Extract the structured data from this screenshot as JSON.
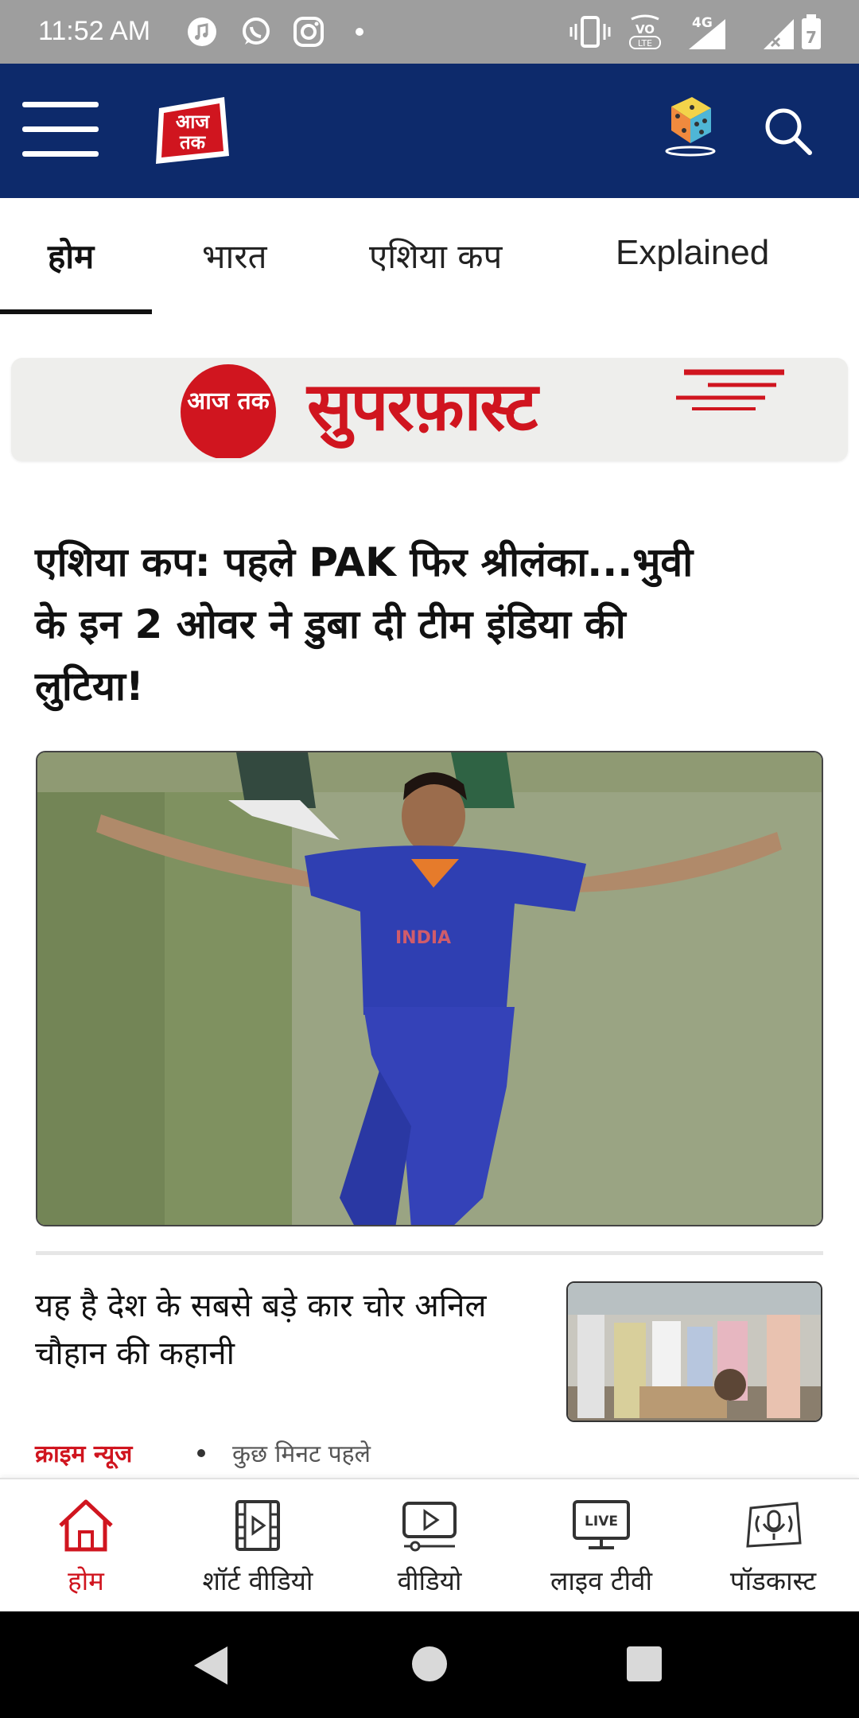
{
  "status_bar": {
    "time": "11:52 AM",
    "network": "4G"
  },
  "header": {
    "logo_text": "आज तक",
    "menu_icon": "hamburger-menu-icon",
    "game_icon": "dice-icon",
    "search_icon": "search-icon",
    "background": "#0d2a6b"
  },
  "tabs": [
    {
      "label": "होम",
      "active": true
    },
    {
      "label": "भारत"
    },
    {
      "label": "एशिया कप"
    },
    {
      "label": "Explained"
    }
  ],
  "banner": {
    "logo_text": "आज तक",
    "title": "सुपरफ़ास्ट"
  },
  "lead_story": {
    "headline": "एशिया कप: पहले PAK फिर श्रीलंका...भुवी के इन 2 ओवर ने डुबा दी टीम इंडिया की लुटिया!"
  },
  "story": {
    "title": "यह है देश के सबसे बड़े कार चोर अनिल चौहान की कहानी",
    "category": "क्राइम न्यूज",
    "time": "कुछ मिनट पहले"
  },
  "bottom_nav": [
    {
      "label": "होम",
      "icon": "home-icon",
      "active": true
    },
    {
      "label": "शॉर्ट वीडियो",
      "icon": "short-video-icon"
    },
    {
      "label": "वीडियो",
      "icon": "video-icon"
    },
    {
      "label": "लाइव टीवी",
      "icon": "live-tv-icon",
      "badge": "LIVE"
    },
    {
      "label": "पॉडकास्ट",
      "icon": "podcast-icon"
    }
  ],
  "colors": {
    "accent": "#d0151f",
    "header_bg": "#0d2a6b"
  }
}
